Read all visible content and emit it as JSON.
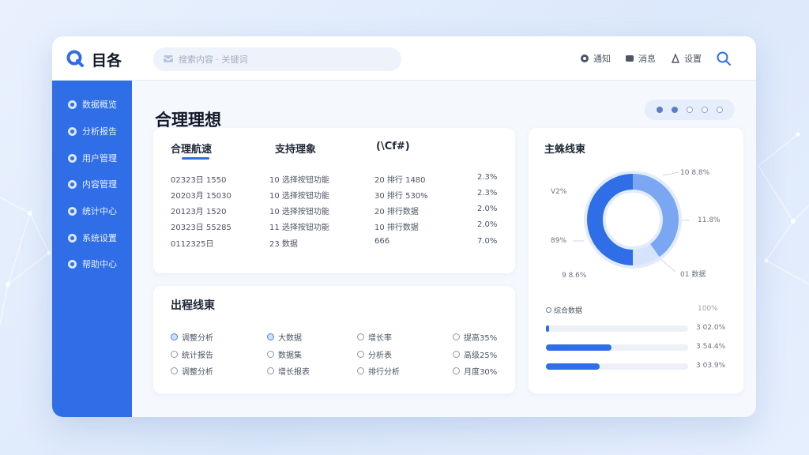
{
  "app": {
    "logo_text": "目各"
  },
  "search": {
    "placeholder": "搜索内容 · 关键词"
  },
  "header_actions": [
    {
      "label": "通知",
      "icon": "bell-icon"
    },
    {
      "label": "消息",
      "icon": "message-icon"
    },
    {
      "label": "设置",
      "icon": "settings-icon"
    }
  ],
  "sidebar": {
    "items": [
      {
        "label": "数据概览"
      },
      {
        "label": "分析报告"
      },
      {
        "label": "用户管理"
      },
      {
        "label": "内容管理"
      },
      {
        "label": "统计中心"
      },
      {
        "label": "系统设置"
      },
      {
        "label": "帮助中心"
      }
    ]
  },
  "page": {
    "title": "合理理想"
  },
  "table": {
    "headers": [
      "合理航速",
      "支持理象",
      "(\\Cf#)"
    ],
    "rows": [
      [
        "02323日 1550",
        "10 选择按钮功能",
        "20 排行 1480",
        "2.3%"
      ],
      [
        "20203月 15030",
        "10 选择按钮功能",
        "30 排行 530%",
        "2.3%"
      ],
      [
        "20123月 1520",
        "10 选择按钮功能",
        "20 排行数据",
        "2.0%"
      ],
      [
        "20323日 55285",
        "11 选择按钮功能",
        "10 排行数据",
        "2.0%"
      ],
      [
        "0112325日",
        "23 数据",
        "666",
        "7.0%"
      ]
    ]
  },
  "summary": {
    "title": "出程线東",
    "stats": [
      [
        "调整分析",
        "大数据",
        "增长率",
        "提高35%"
      ],
      [
        "统计报告",
        "数据集",
        "分析表",
        "高级25%"
      ],
      [
        "调整分析",
        "增长报表",
        "排行分析",
        "月度30%"
      ]
    ]
  },
  "donut_card": {
    "title": "主蛛线東",
    "labels": {
      "top_right": "10 8.8%",
      "left": "V2%",
      "right": "11.8%",
      "left_low": "89%",
      "bottom_left": "9 8.6%",
      "bottom_right": "01 数据"
    },
    "legend_header": "综合数据",
    "legend_right": "100%"
  },
  "chart_data": {
    "type": "pie",
    "title": "主蛛线東",
    "slices": [
      {
        "label": "11.8%",
        "value": 50,
        "color": "#2f6ee6"
      },
      {
        "label": "10 8.8%",
        "value": 40,
        "color": "#7aa6f2"
      },
      {
        "label": "01 数据",
        "value": 10,
        "color": "#d6e4fb"
      }
    ]
  },
  "progress": [
    {
      "value": 2,
      "label": "3 02.0%"
    },
    {
      "value": 46,
      "label": "3 54.4%"
    },
    {
      "value": 38,
      "label": "3 03.9%"
    }
  ],
  "colors": {
    "accent": "#2f6ee6",
    "sidebar": "#2f6ee6",
    "accent_light": "#7aa6f2",
    "track": "#edf1f7"
  }
}
